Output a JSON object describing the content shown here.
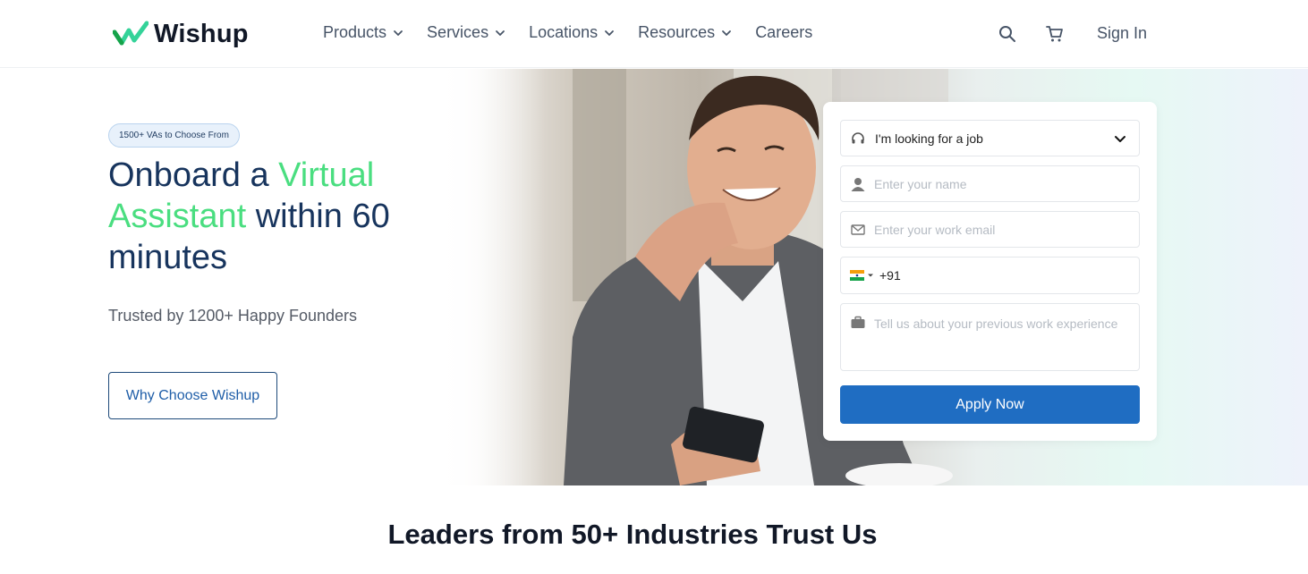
{
  "header": {
    "logo_text": "Wishup",
    "nav": [
      {
        "label": "Products",
        "has_dropdown": true
      },
      {
        "label": "Services",
        "has_dropdown": true
      },
      {
        "label": "Locations",
        "has_dropdown": true
      },
      {
        "label": "Resources",
        "has_dropdown": true
      },
      {
        "label": "Careers",
        "has_dropdown": false
      }
    ],
    "icons": [
      "search-icon",
      "cart-icon"
    ],
    "signin_label": "Sign In"
  },
  "hero": {
    "badge": "1500+ VAs to Choose From",
    "headline_part1": "Onboard a ",
    "headline_accent": "Virtual Assistant",
    "headline_part2": " within 60 minutes",
    "subhead": "Trusted by 1200+ Happy Founders",
    "cta_label": "Why Choose Wishup"
  },
  "form": {
    "role_select": "I'm looking for a job",
    "name_placeholder": "Enter your name",
    "email_placeholder": "Enter your work email",
    "phone_prefix": "+91",
    "experience_placeholder": "Tell us about your previous work experience",
    "submit_label": "Apply Now"
  },
  "section": {
    "title": "Leaders from 50+ Industries Trust Us"
  },
  "colors": {
    "accent_green": "#4ade80",
    "primary_blue": "#1f6dc2",
    "headline_navy": "#17345d"
  }
}
